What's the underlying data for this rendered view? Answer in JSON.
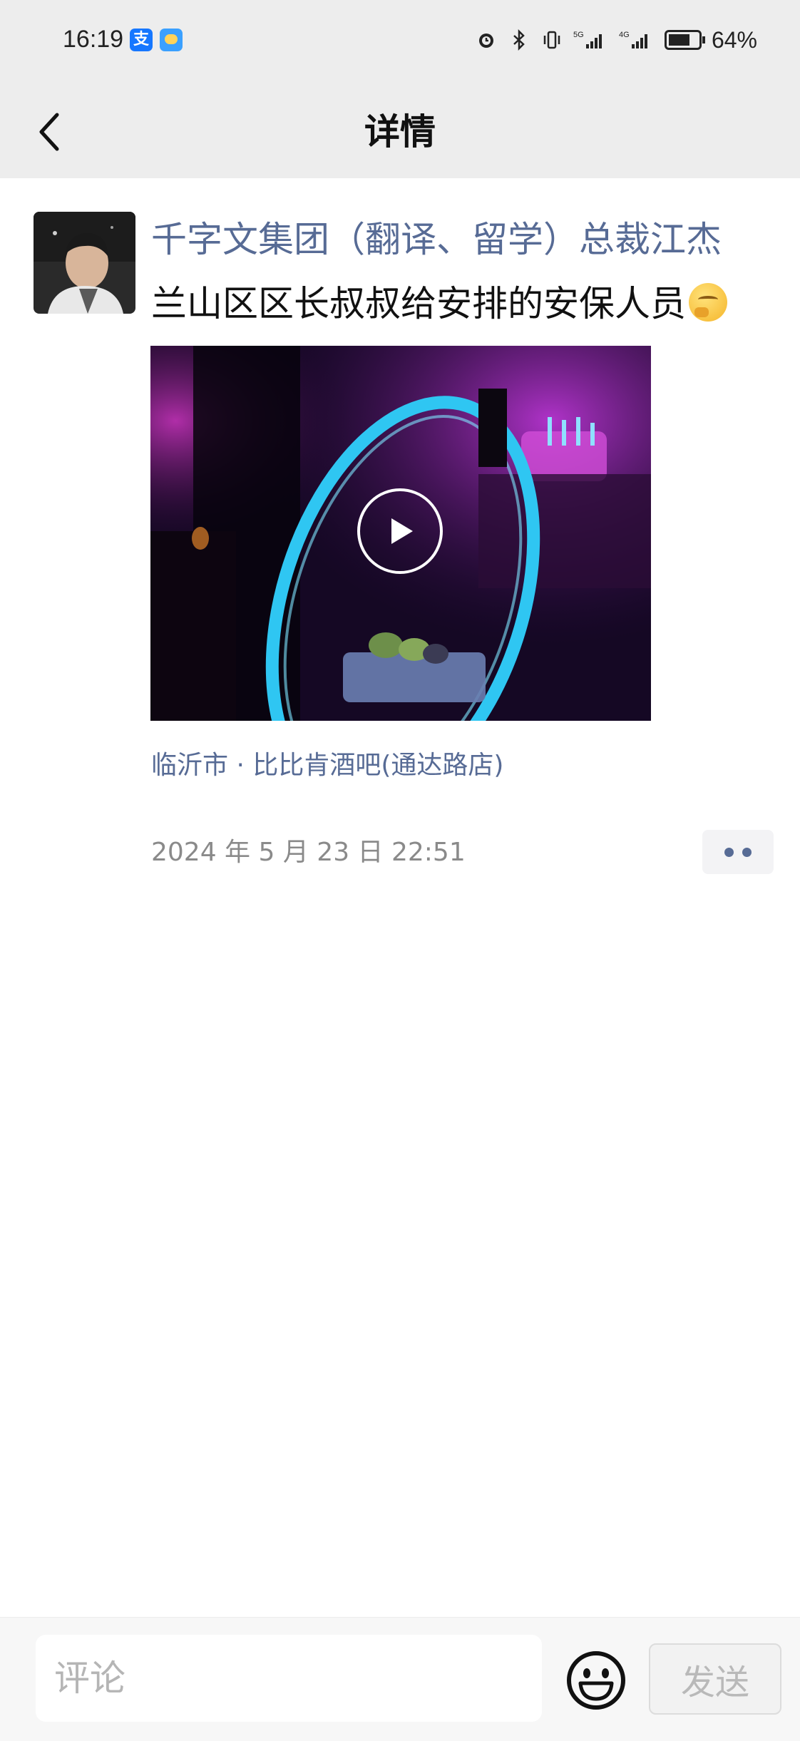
{
  "status_bar": {
    "time": "16:19",
    "alipay_glyph": "支",
    "battery_percent": "64%",
    "icons": [
      "alarm-icon",
      "bluetooth-icon",
      "vibrate-icon",
      "5g-signal-icon",
      "4g-signal-icon",
      "battery-icon"
    ]
  },
  "nav": {
    "title": "详情",
    "back_icon": "chevron-left-icon"
  },
  "post": {
    "author": "千字文集团（翻译、留学）总裁江杰",
    "text": "兰山区区长叔叔给安排的安保人员",
    "emoji": "thinking-face",
    "location": "临沂市 · 比比肯酒吧(通达路店)",
    "timestamp": "2024 年 5 月 23 日 22:51",
    "video_icon": "play-icon"
  },
  "comment_bar": {
    "placeholder": "评论",
    "value": "",
    "send_label": "发送",
    "emoji_icon": "smiley-icon"
  },
  "colors": {
    "link": "#576b95",
    "bar_background": "#ededed",
    "timestamp": "#8a8a8a"
  }
}
